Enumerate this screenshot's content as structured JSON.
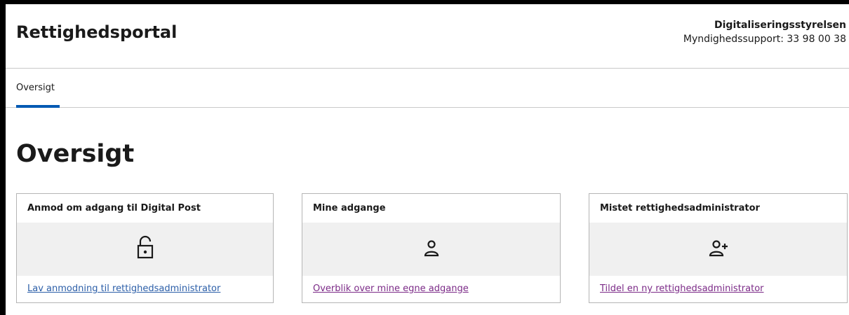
{
  "header": {
    "app_title": "Rettighedsportal",
    "org_name": "Digitaliseringsstyrelsen",
    "support": "Myndighedssupport: 33 98 00 38"
  },
  "tabs": [
    {
      "label": "Oversigt",
      "active": true
    }
  ],
  "page_title": "Oversigt",
  "cards": [
    {
      "title": "Anmod om adgang til Digital Post",
      "icon": "unlock-icon",
      "link": "Lav anmodning til rettighedsadministrator",
      "link_color": "#2b5ea8"
    },
    {
      "title": "Mine adgange",
      "icon": "user-icon",
      "link": "Overblik over mine egne adgange",
      "link_color": "#7b2a87"
    },
    {
      "title": "Mistet rettighedsadministrator",
      "icon": "user-add-icon",
      "link": "Tildel en ny rettighedsadministrator",
      "link_color": "#7b2a87"
    }
  ],
  "colors": {
    "accent": "#0059b3",
    "band": "#f0f0f0"
  }
}
